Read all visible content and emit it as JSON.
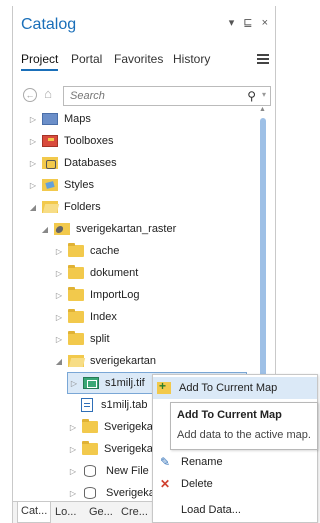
{
  "pane": {
    "title": "Catalog",
    "controls": "▾ ⊑ ×"
  },
  "tabs": [
    "Project",
    "Portal",
    "Favorites",
    "History"
  ],
  "search": {
    "placeholder": "Search"
  },
  "tree": [
    {
      "label": "Maps",
      "icon": "maps-icon",
      "expander": "▷"
    },
    {
      "label": "Toolboxes",
      "icon": "toolboxes-icon",
      "expander": "▷"
    },
    {
      "label": "Databases",
      "icon": "databases-icon",
      "expander": "▷"
    },
    {
      "label": "Styles",
      "icon": "styles-icon",
      "expander": "▷"
    },
    {
      "label": "Folders",
      "icon": "folder-icon",
      "expander": "◢"
    },
    {
      "label": "sverigekartan_raster",
      "icon": "folder-connection-icon",
      "expander": "◢"
    },
    {
      "label": "cache",
      "icon": "folder-icon",
      "expander": "▷"
    },
    {
      "label": "dokument",
      "icon": "folder-icon",
      "expander": "▷"
    },
    {
      "label": "ImportLog",
      "icon": "folder-icon",
      "expander": "▷"
    },
    {
      "label": "Index",
      "icon": "folder-icon",
      "expander": "▷"
    },
    {
      "label": "split",
      "icon": "folder-icon",
      "expander": "▷"
    },
    {
      "label": "sverigekartan",
      "icon": "folder-icon",
      "expander": "◢"
    },
    {
      "label": "s1milj.tif",
      "icon": "raster-icon",
      "expander": "▷"
    },
    {
      "label": "s1milj.tab",
      "icon": "file-icon",
      "expander": ""
    },
    {
      "label": "Sverigekarta",
      "icon": "folder-icon",
      "expander": "▷"
    },
    {
      "label": "Sverigekarta",
      "icon": "folder-icon",
      "expander": "▷"
    },
    {
      "label": "New File Ge",
      "icon": "geodatabase-icon",
      "expander": "▷"
    },
    {
      "label": "Sverigekarta",
      "icon": "geodatabase-icon",
      "expander": "▷"
    }
  ],
  "bottom_tabs": [
    "Cat...",
    "Lo...",
    "Ge...",
    "Cre..."
  ],
  "context_menu": {
    "items": [
      "Add To Current Map",
      "Rename",
      "Delete",
      "Load Data..."
    ]
  },
  "tooltip": {
    "title": "Add To Current Map",
    "description": "Add data to the active map."
  },
  "colors": {
    "accent": "#1a6fb9",
    "selection": "#dbe9f7",
    "folder": "#f2c94c",
    "delete": "#d0402f"
  }
}
